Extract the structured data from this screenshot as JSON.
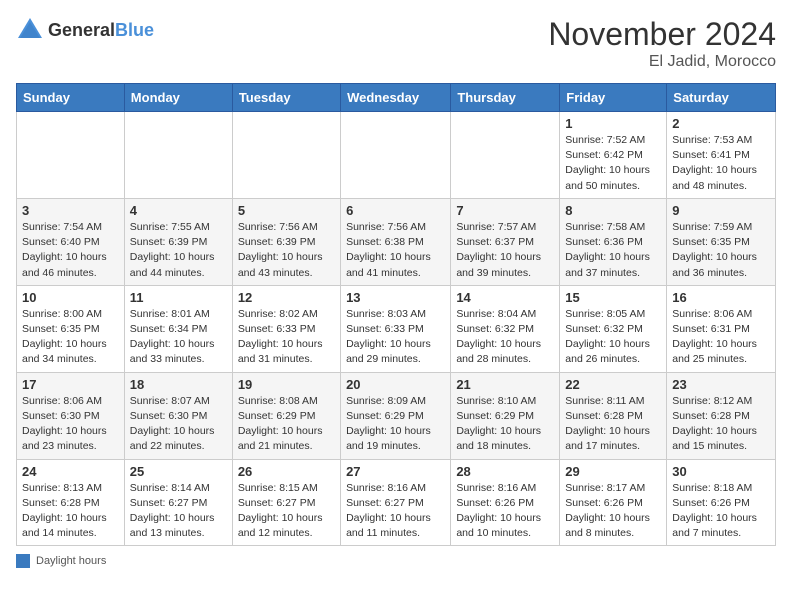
{
  "header": {
    "logo_general": "General",
    "logo_blue": "Blue",
    "month": "November 2024",
    "location": "El Jadid, Morocco"
  },
  "days_of_week": [
    "Sunday",
    "Monday",
    "Tuesday",
    "Wednesday",
    "Thursday",
    "Friday",
    "Saturday"
  ],
  "legend_label": "Daylight hours",
  "weeks": [
    [
      {
        "day": "",
        "info": ""
      },
      {
        "day": "",
        "info": ""
      },
      {
        "day": "",
        "info": ""
      },
      {
        "day": "",
        "info": ""
      },
      {
        "day": "",
        "info": ""
      },
      {
        "day": "1",
        "info": "Sunrise: 7:52 AM\nSunset: 6:42 PM\nDaylight: 10 hours and 50 minutes."
      },
      {
        "day": "2",
        "info": "Sunrise: 7:53 AM\nSunset: 6:41 PM\nDaylight: 10 hours and 48 minutes."
      }
    ],
    [
      {
        "day": "3",
        "info": "Sunrise: 7:54 AM\nSunset: 6:40 PM\nDaylight: 10 hours and 46 minutes."
      },
      {
        "day": "4",
        "info": "Sunrise: 7:55 AM\nSunset: 6:39 PM\nDaylight: 10 hours and 44 minutes."
      },
      {
        "day": "5",
        "info": "Sunrise: 7:56 AM\nSunset: 6:39 PM\nDaylight: 10 hours and 43 minutes."
      },
      {
        "day": "6",
        "info": "Sunrise: 7:56 AM\nSunset: 6:38 PM\nDaylight: 10 hours and 41 minutes."
      },
      {
        "day": "7",
        "info": "Sunrise: 7:57 AM\nSunset: 6:37 PM\nDaylight: 10 hours and 39 minutes."
      },
      {
        "day": "8",
        "info": "Sunrise: 7:58 AM\nSunset: 6:36 PM\nDaylight: 10 hours and 37 minutes."
      },
      {
        "day": "9",
        "info": "Sunrise: 7:59 AM\nSunset: 6:35 PM\nDaylight: 10 hours and 36 minutes."
      }
    ],
    [
      {
        "day": "10",
        "info": "Sunrise: 8:00 AM\nSunset: 6:35 PM\nDaylight: 10 hours and 34 minutes."
      },
      {
        "day": "11",
        "info": "Sunrise: 8:01 AM\nSunset: 6:34 PM\nDaylight: 10 hours and 33 minutes."
      },
      {
        "day": "12",
        "info": "Sunrise: 8:02 AM\nSunset: 6:33 PM\nDaylight: 10 hours and 31 minutes."
      },
      {
        "day": "13",
        "info": "Sunrise: 8:03 AM\nSunset: 6:33 PM\nDaylight: 10 hours and 29 minutes."
      },
      {
        "day": "14",
        "info": "Sunrise: 8:04 AM\nSunset: 6:32 PM\nDaylight: 10 hours and 28 minutes."
      },
      {
        "day": "15",
        "info": "Sunrise: 8:05 AM\nSunset: 6:32 PM\nDaylight: 10 hours and 26 minutes."
      },
      {
        "day": "16",
        "info": "Sunrise: 8:06 AM\nSunset: 6:31 PM\nDaylight: 10 hours and 25 minutes."
      }
    ],
    [
      {
        "day": "17",
        "info": "Sunrise: 8:06 AM\nSunset: 6:30 PM\nDaylight: 10 hours and 23 minutes."
      },
      {
        "day": "18",
        "info": "Sunrise: 8:07 AM\nSunset: 6:30 PM\nDaylight: 10 hours and 22 minutes."
      },
      {
        "day": "19",
        "info": "Sunrise: 8:08 AM\nSunset: 6:29 PM\nDaylight: 10 hours and 21 minutes."
      },
      {
        "day": "20",
        "info": "Sunrise: 8:09 AM\nSunset: 6:29 PM\nDaylight: 10 hours and 19 minutes."
      },
      {
        "day": "21",
        "info": "Sunrise: 8:10 AM\nSunset: 6:29 PM\nDaylight: 10 hours and 18 minutes."
      },
      {
        "day": "22",
        "info": "Sunrise: 8:11 AM\nSunset: 6:28 PM\nDaylight: 10 hours and 17 minutes."
      },
      {
        "day": "23",
        "info": "Sunrise: 8:12 AM\nSunset: 6:28 PM\nDaylight: 10 hours and 15 minutes."
      }
    ],
    [
      {
        "day": "24",
        "info": "Sunrise: 8:13 AM\nSunset: 6:28 PM\nDaylight: 10 hours and 14 minutes."
      },
      {
        "day": "25",
        "info": "Sunrise: 8:14 AM\nSunset: 6:27 PM\nDaylight: 10 hours and 13 minutes."
      },
      {
        "day": "26",
        "info": "Sunrise: 8:15 AM\nSunset: 6:27 PM\nDaylight: 10 hours and 12 minutes."
      },
      {
        "day": "27",
        "info": "Sunrise: 8:16 AM\nSunset: 6:27 PM\nDaylight: 10 hours and 11 minutes."
      },
      {
        "day": "28",
        "info": "Sunrise: 8:16 AM\nSunset: 6:26 PM\nDaylight: 10 hours and 10 minutes."
      },
      {
        "day": "29",
        "info": "Sunrise: 8:17 AM\nSunset: 6:26 PM\nDaylight: 10 hours and 8 minutes."
      },
      {
        "day": "30",
        "info": "Sunrise: 8:18 AM\nSunset: 6:26 PM\nDaylight: 10 hours and 7 minutes."
      }
    ]
  ]
}
